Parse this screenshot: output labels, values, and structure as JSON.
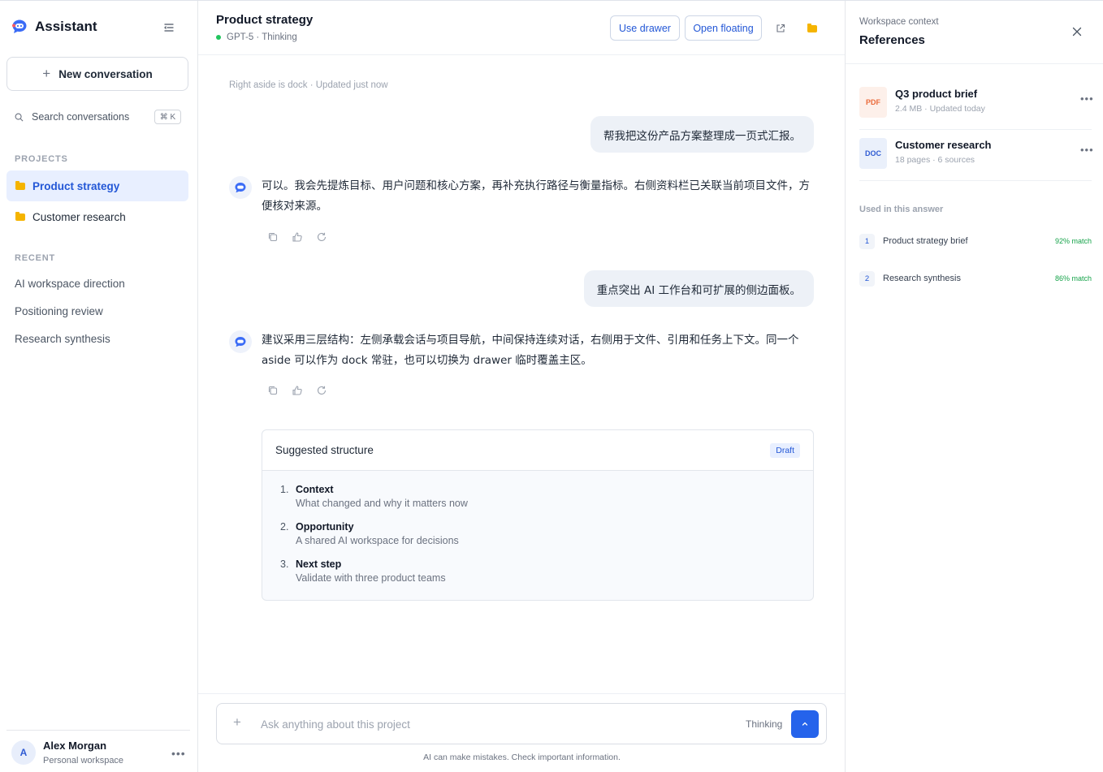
{
  "sidebar": {
    "brand": "Assistant",
    "new_conversation": "New conversation",
    "search_label": "Search conversations",
    "search_shortcut": "⌘ K",
    "projects_label": "PROJECTS",
    "projects": [
      {
        "label": "Product strategy",
        "active": true
      },
      {
        "label": "Customer research",
        "active": false
      }
    ],
    "recent_label": "RECENT",
    "recent": [
      {
        "label": "AI workspace direction"
      },
      {
        "label": "Positioning review"
      },
      {
        "label": "Research synthesis"
      }
    ],
    "user": {
      "initial": "A",
      "name": "Alex Morgan",
      "subtitle": "Personal workspace",
      "more": "•••"
    }
  },
  "header": {
    "title": "Product strategy",
    "model": "GPT-5 · Thinking",
    "use_drawer": "Use drawer",
    "open_floating": "Open floating",
    "status_color": "#22c55e",
    "accent": "#2563eb"
  },
  "chat": {
    "meta": "Right aside is dock  ·  Updated just now",
    "messages": [
      {
        "role": "user",
        "text": "帮我把这份产品方案整理成一页式汇报。"
      },
      {
        "role": "assistant",
        "text": "可以。我会先提炼目标、用户问题和核心方案，再补充执行路径与衡量指标。右侧资料栏已关联当前项目文件，方便核对来源。"
      },
      {
        "role": "user",
        "text": "重点突出 AI 工作台和可扩展的侧边面板。"
      },
      {
        "role": "assistant",
        "text": "建议采用三层结构：左侧承载会话与项目导航，中间保持连续对话，右侧用于文件、引用和任务上下文。同一个 aside 可以作为 dock 常驻，也可以切换为 drawer 临时覆盖主区。"
      }
    ],
    "structure": {
      "title": "Suggested structure",
      "badge": "Draft",
      "items": [
        {
          "num": "1.",
          "title": "Context",
          "desc": "What changed and why it matters now"
        },
        {
          "num": "2.",
          "title": "Opportunity",
          "desc": "A shared AI workspace for decisions"
        },
        {
          "num": "3.",
          "title": "Next step",
          "desc": "Validate with three product teams"
        }
      ]
    }
  },
  "composer": {
    "placeholder": "Ask anything about this project",
    "mode": "Thinking",
    "disclaimer": "AI can make mistakes. Check important information."
  },
  "aside": {
    "eyebrow": "Workspace context",
    "title": "References",
    "files": [
      {
        "badge": "PDF",
        "name": "Q3 product brief",
        "meta": "2.4 MB · Updated today",
        "badge_bg": "#fdf0ea",
        "badge_color": "#ea6a3a"
      },
      {
        "badge": "DOC",
        "name": "Customer research",
        "meta": "18 pages · 6 sources",
        "badge_bg": "#eaf0fb",
        "badge_color": "#2f5bd3"
      }
    ],
    "used_label": "Used in this answer",
    "used": [
      {
        "num": "1",
        "name": "Product strategy brief",
        "match": "92% match"
      },
      {
        "num": "2",
        "name": "Research synthesis",
        "match": "86% match"
      }
    ],
    "more": "•••"
  }
}
